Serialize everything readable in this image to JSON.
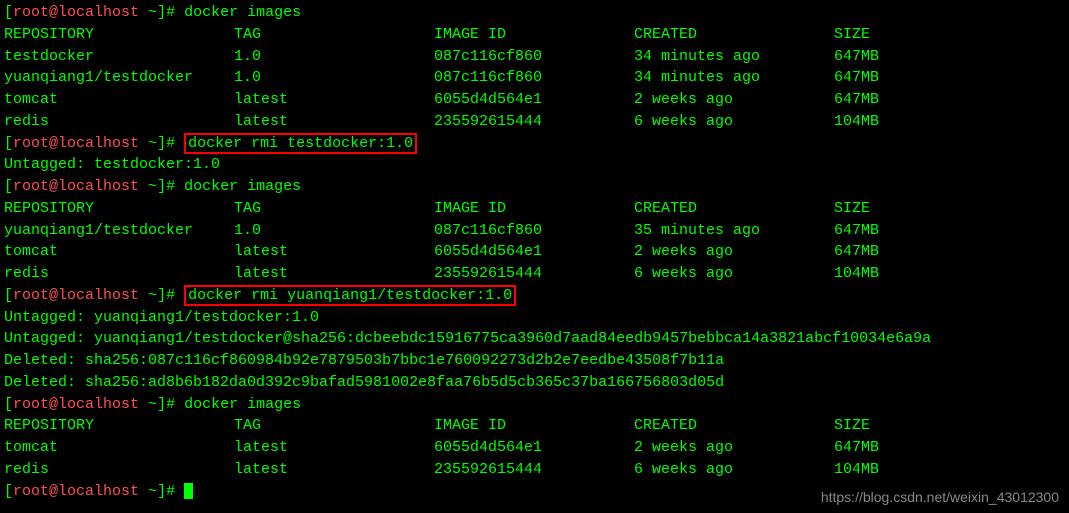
{
  "prompt": {
    "open": "[",
    "user": "root@localhost",
    "tilde": " ~",
    "close": "]#",
    "space": " "
  },
  "cmd1": "docker images",
  "headers": {
    "repo": "REPOSITORY",
    "tag": "TAG",
    "id": "IMAGE ID",
    "created": "CREATED",
    "size": "SIZE"
  },
  "table1": [
    {
      "repo": "testdocker",
      "tag": "1.0",
      "id": "087c116cf860",
      "created": "34 minutes ago",
      "size": "647MB"
    },
    {
      "repo": "yuanqiang1/testdocker",
      "tag": "1.0",
      "id": "087c116cf860",
      "created": "34 minutes ago",
      "size": "647MB"
    },
    {
      "repo": "tomcat",
      "tag": "latest",
      "id": "6055d4d564e1",
      "created": "2 weeks ago",
      "size": "647MB"
    },
    {
      "repo": "redis",
      "tag": "latest",
      "id": "235592615444",
      "created": "6 weeks ago",
      "size": "104MB"
    }
  ],
  "cmd2": "docker rmi testdocker:1.0",
  "out2": "Untagged: testdocker:1.0",
  "cmd3": "docker images",
  "table2": [
    {
      "repo": "yuanqiang1/testdocker",
      "tag": "1.0",
      "id": "087c116cf860",
      "created": "35 minutes ago",
      "size": "647MB"
    },
    {
      "repo": "tomcat",
      "tag": "latest",
      "id": "6055d4d564e1",
      "created": "2 weeks ago",
      "size": "647MB"
    },
    {
      "repo": "redis",
      "tag": "latest",
      "id": "235592615444",
      "created": "6 weeks ago",
      "size": "104MB"
    }
  ],
  "cmd4": "docker rmi yuanqiang1/testdocker:1.0",
  "out4a": "Untagged: yuanqiang1/testdocker:1.0",
  "out4b": "Untagged: yuanqiang1/testdocker@sha256:dcbeebdc15916775ca3960d7aad84eedb9457bebbca14a3821abcf10034e6a9a",
  "out4c": "Deleted: sha256:087c116cf860984b92e7879503b7bbc1e760092273d2b2e7eedbe43508f7b11a",
  "out4d": "Deleted: sha256:ad8b6b182da0d392c9bafad5981002e8faa76b5d5cb365c37ba166756803d05d",
  "cmd5": "docker images",
  "table3": [
    {
      "repo": "tomcat",
      "tag": "latest",
      "id": "6055d4d564e1",
      "created": "2 weeks ago",
      "size": "647MB"
    },
    {
      "repo": "redis",
      "tag": "latest",
      "id": "235592615444",
      "created": "6 weeks ago",
      "size": "104MB"
    }
  ],
  "watermark": "https://blog.csdn.net/weixin_43012300"
}
